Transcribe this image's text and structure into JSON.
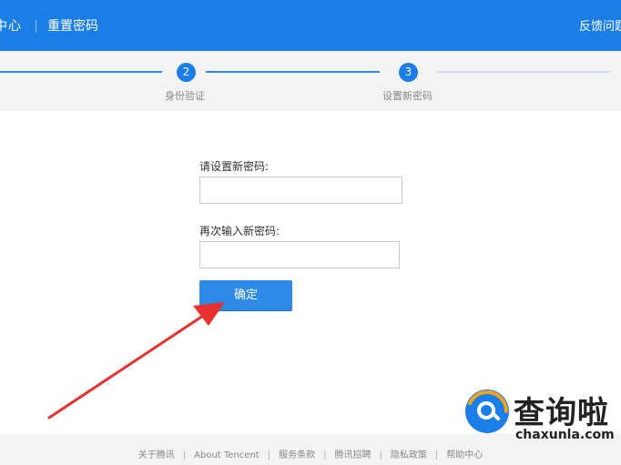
{
  "header": {
    "left_title": "中心",
    "page_title": "重置密码",
    "feedback": "反馈问题"
  },
  "steps": [
    {
      "number": "2",
      "label": "身份验证"
    },
    {
      "number": "3",
      "label": "设置新密码"
    }
  ],
  "form": {
    "new_password_label": "请设置新密码:",
    "new_password_value": "",
    "confirm_password_label": "再次输入新密码:",
    "confirm_password_value": "",
    "confirm_button": "确定"
  },
  "footer": {
    "links": [
      "关于腾讯",
      "About Tencent",
      "服务条款",
      "腾讯招聘",
      "隐私政策",
      "帮助中心"
    ],
    "separator": "|"
  },
  "watermark": {
    "brand": "查询啦",
    "url": "chaxunla.com"
  },
  "colors": {
    "brand_blue": "#1a7ee6",
    "button_blue": "#2d8ae6",
    "annotation_arrow": "#e8312f"
  }
}
